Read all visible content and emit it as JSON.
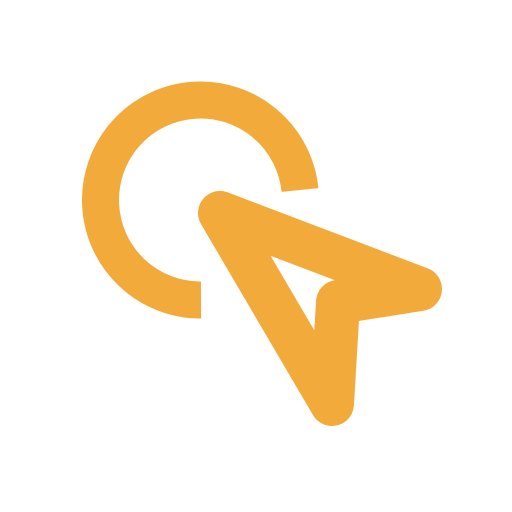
{
  "icon": {
    "name": "click-cursor-icon",
    "color": "#F2AA3A",
    "background": "#FFFFFF"
  }
}
